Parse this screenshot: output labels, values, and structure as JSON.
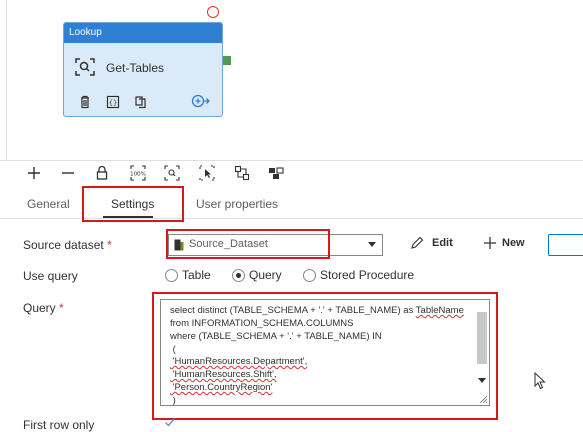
{
  "canvas": {
    "activity": {
      "type_label": "Lookup",
      "name": "Get-Tables",
      "icons": [
        "search-icon",
        "delete-icon",
        "code-icon",
        "copy-icon",
        "arrow-forward-icon"
      ]
    }
  },
  "toolbar": {
    "icons": [
      "add-icon",
      "remove-icon",
      "lock-icon",
      "zoom-100-icon",
      "zoom-fit-icon",
      "select-icon",
      "auto-align-icon",
      "layout-icon"
    ]
  },
  "tabs": [
    {
      "label": "General",
      "active": false
    },
    {
      "label": "Settings",
      "active": true
    },
    {
      "label": "User properties",
      "active": false
    }
  ],
  "settings": {
    "source_dataset_label": "Source dataset",
    "source_dataset_value": "Source_Dataset",
    "edit_label": "Edit",
    "new_label": "New",
    "use_query_label": "Use query",
    "use_query_options": [
      "Table",
      "Query",
      "Stored Procedure"
    ],
    "use_query_selected": "Query",
    "query_label": "Query",
    "required_mark": "*",
    "query_text": [
      "select distinct (TABLE_SCHEMA + '.' + TABLE_NAME) as TableName",
      "from INFORMATION_SCHEMA.COLUMNS",
      "where (TABLE_SCHEMA + '.' + TABLE_NAME) IN",
      " (",
      " 'HumanResources.Department',",
      " 'HumanResources.Shift',",
      " 'Person.CountryRegion'",
      " )"
    ],
    "first_row_only_label": "First row only",
    "first_row_only_checked": true
  },
  "colors": {
    "accent": "#0078d4",
    "activity_header": "#2f7fd3",
    "activity_body": "#dbeaf8",
    "highlight_box": "#d41919",
    "success_port": "#4e9a4e"
  }
}
